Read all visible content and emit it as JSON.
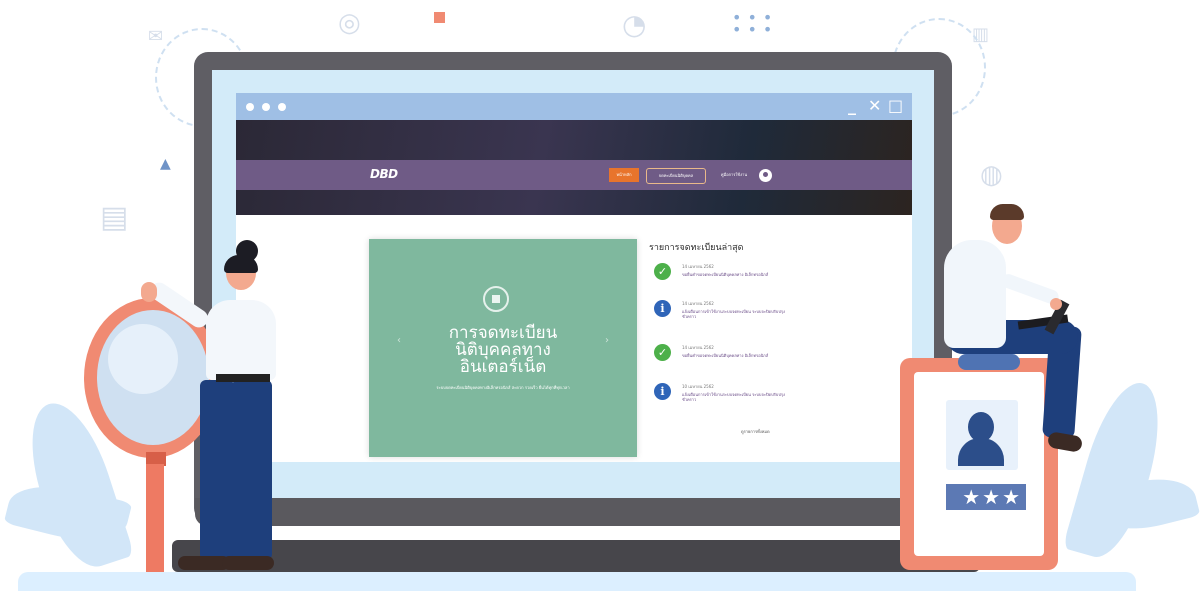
{
  "browser": {
    "window_controls": {
      "minimize": "_",
      "close": "✕",
      "maximize": "□"
    },
    "site_logo": "DBD",
    "nav": {
      "home": "หน้าหลัก",
      "register": "จดทะเบียนนิติบุคคล",
      "guide": "คู่มือการใช้งาน"
    },
    "banner": {
      "title_lines": [
        "การจดทะเบียน",
        "นิติบุคคลทาง",
        "อินเตอร์เน็ต"
      ],
      "description": "ระบบจดทะเบียนนิติบุคคลทางอิเล็กทรอนิกส์ สะดวก รวดเร็ว ยื่นได้ทุกที่ทุกเวลา"
    },
    "latest": {
      "title": "รายการจดทะเบียนล่าสุด",
      "items": [
        {
          "status": "success",
          "badge": "✓",
          "date": "14 เมษายน 2562",
          "text": "ขอยื่นคำขอจดทะเบียนนิติบุคคลทาง อิเล็กทรอนิกส์"
        },
        {
          "status": "info",
          "badge": "i",
          "date": "14 เมษายน 2562",
          "text": "แจ้งเตือนการเข้าใช้งานระบบจดทะเบียน ระบบจะปิดปรับปรุงชั่วคราว"
        },
        {
          "status": "success",
          "badge": "✓",
          "date": "14 เมษายน 2562",
          "text": "ขอยื่นคำขอจดทะเบียนนิติบุคคลทาง อิเล็กทรอนิกส์"
        },
        {
          "status": "info",
          "badge": "i",
          "date": "10 เมษายน 2562",
          "text": "แจ้งเตือนการเข้าใช้งานระบบจดทะเบียน ระบบจะปิดปรับปรุงชั่วคราว"
        }
      ],
      "see_all": "ดูรายการทั้งหมด"
    }
  },
  "profile_card": {
    "stars": "★★★"
  },
  "colors": {
    "laptop": "#5f5e64",
    "navbar": "#6f5b86",
    "accent_orange": "#e8742c",
    "banner_green": "#7fb89e",
    "success": "#4db04a",
    "info": "#2f65b8",
    "coral": "#f08a72",
    "navy": "#1e3f7c"
  },
  "icons": [
    "envelope-icon",
    "pie-chart-icon",
    "bar-chart-icon",
    "globe-icon",
    "dots-icon",
    "triangle-icon",
    "user-icon",
    "star-icon"
  ]
}
